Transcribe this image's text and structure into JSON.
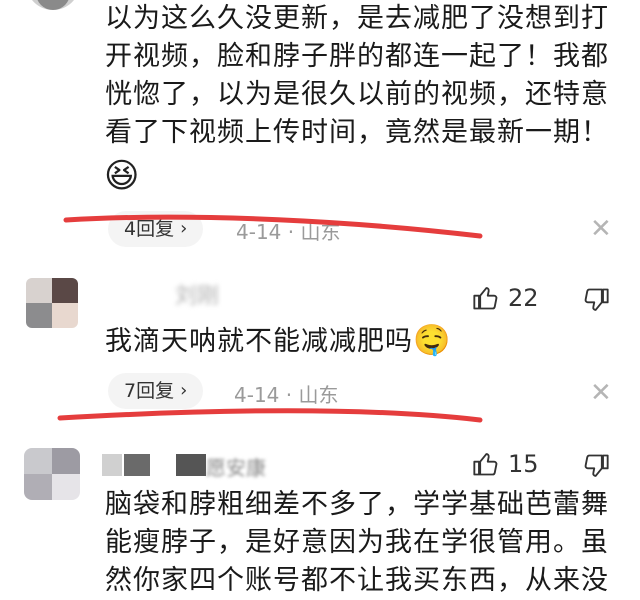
{
  "comments": [
    {
      "text_lines": [
        "以为这么久没更新，是去减肥了没想到打",
        "开视频，脸和脖子胖的都连一起了！我都",
        "恍惚了，以为是很久以前的视频，还特意",
        "看了下视频上传时间，竟然是最新一期！"
      ],
      "emoji": "😆",
      "reply_label": "4回复",
      "date": "4-14",
      "location": "山东"
    },
    {
      "username": "刘刚",
      "likes": "22",
      "text": "我滴天呐就不能减减肥吗",
      "emoji": "🤤",
      "reply_label": "7回复",
      "date": "4-14",
      "location": "山东"
    },
    {
      "username": "愿安康",
      "likes": "15",
      "text_lines": [
        "脑袋和脖粗细差不多了，学学基础芭蕾舞",
        "能瘦脖子，是好意因为我在学很管用。虽",
        "然你家四个账号都不让我买东西，从来没"
      ]
    }
  ],
  "icons": {
    "like": "thumbs-up-icon",
    "dislike": "thumbs-down-icon",
    "close": "close-icon",
    "chevron": "chevron-right-icon"
  },
  "colors": {
    "annotation_red": "#e53d3d",
    "meta_gray": "#9a9a9a"
  },
  "separator": "·"
}
